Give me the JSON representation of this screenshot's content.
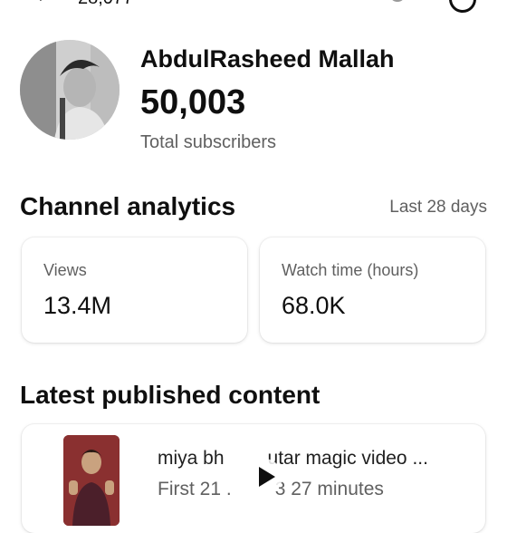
{
  "status_fragment": "28,077",
  "channel": {
    "name": "AbdulRasheed Mallah",
    "subscribers": "50,003",
    "subscribers_label": "Total subscribers"
  },
  "analytics": {
    "title": "Channel analytics",
    "range": "Last 28 days",
    "metrics": [
      {
        "label": "Views",
        "value": "13.4M"
      },
      {
        "label": "Watch time (hours)",
        "value": "68.0K"
      }
    ]
  },
  "latest": {
    "title": "Latest published content",
    "video": {
      "title_left": "miya bh",
      "title_right": "utar magic video ...",
      "sub_left": "First 21 .",
      "sub_right": "3 27 minutes"
    }
  },
  "colors": {
    "text": "#0f0f0f",
    "secondary": "#606060",
    "card_bg": "#ffffff"
  }
}
